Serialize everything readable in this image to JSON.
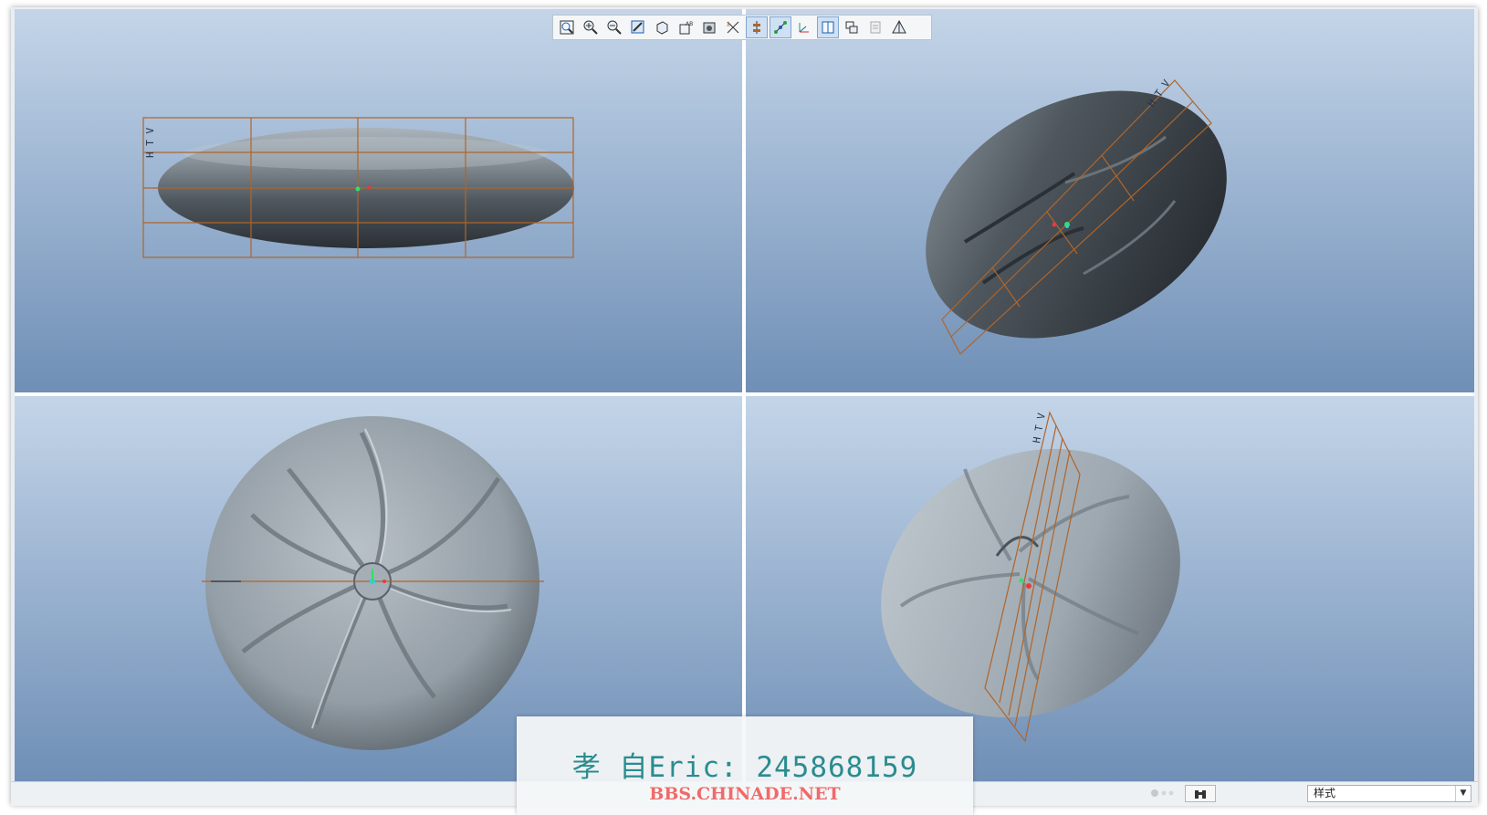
{
  "toolbar": {
    "buttons": [
      {
        "icon": "refit-icon",
        "active": false
      },
      {
        "icon": "zoom-in-icon",
        "active": false
      },
      {
        "icon": "zoom-out-icon",
        "active": false
      },
      {
        "icon": "repaint-icon",
        "active": false
      },
      {
        "icon": "orient-mode-icon",
        "active": false
      },
      {
        "icon": "saved-views-icon",
        "active": false
      },
      {
        "icon": "display-style-icon",
        "active": false
      },
      {
        "icon": "datum-planes-icon",
        "active": false
      },
      {
        "icon": "datum-axes-icon",
        "active": true
      },
      {
        "icon": "datum-points-icon",
        "active": true
      },
      {
        "icon": "csys-display-icon",
        "active": false
      },
      {
        "icon": "spin-center-icon",
        "active": true
      },
      {
        "icon": "annotations-icon",
        "active": false
      },
      {
        "icon": "appearance-icon",
        "active": false
      },
      {
        "icon": "view-manager-icon",
        "active": false
      }
    ]
  },
  "statusbar": {
    "filter_icon": "binoculars-icon",
    "selection_filter": "样式"
  },
  "watermark": {
    "line1": "孝 自Eric: 245868159",
    "line2": "BBS.CHINADE.NET"
  },
  "colors": {
    "datum": "#b0652a",
    "model_dark": "#3a4148",
    "model_light": "#c9d2d9",
    "watermark_teal": "#2a8c8e",
    "watermark_red": "#f06a6a"
  }
}
